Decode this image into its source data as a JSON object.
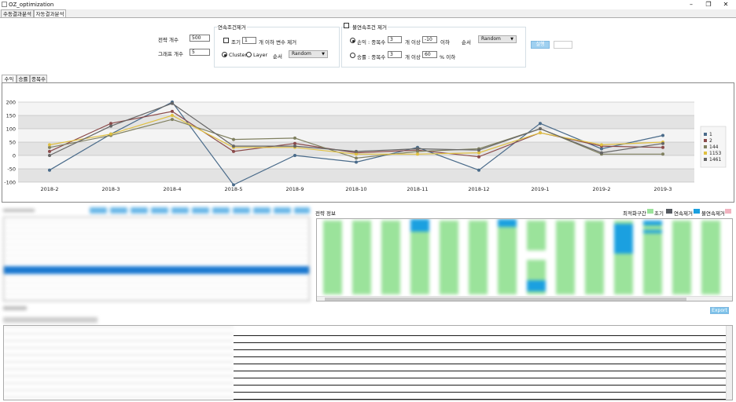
{
  "window": {
    "title": "OZ_optimization",
    "minimize": "–",
    "maximize": "❐",
    "close": "✕"
  },
  "main_tabs": [
    "수동결과분석",
    "자동결과분석"
  ],
  "params": {
    "strategy_count_label": "전략 개수",
    "strategy_count": "500",
    "graph_count_label": "그래프 개수",
    "graph_count": "5"
  },
  "cont_remove": {
    "title": "연속조건제거",
    "early_label": "조기",
    "early_value": "1",
    "early_suffix": "개 이하 변수 제거",
    "cluster_label": "Cluster",
    "layer_label": "Layer",
    "order_label": "순서",
    "order_value": "Random"
  },
  "noncont_remove": {
    "title": "불연속조건 제거",
    "loss_label": "손익 : 종목수",
    "loss_count": "3",
    "loss_mid": "개 이상",
    "loss_value": "-10",
    "loss_suffix": "이하",
    "order_label": "순서",
    "order_value": "Random",
    "win_label": "승률 : 종목수",
    "win_count": "3",
    "win_mid": "개 이상",
    "win_value": "60",
    "win_suffix": "% 이하"
  },
  "run_button": "실행",
  "chart_tabs": [
    "수익",
    "승률",
    "종목수"
  ],
  "strategy_info": {
    "title": "전략 정보",
    "legend_title": "최적화구간",
    "legend": [
      "초기",
      "연속제거",
      "불연속제거"
    ]
  },
  "export_button": "Export",
  "colors": {
    "early": "#9be39b",
    "cont": "#555a60",
    "noncont": "#1ba0e0",
    "dis": "#f2b3c0",
    "selection": "#1a78d0"
  },
  "chart_data": {
    "type": "line",
    "categories": [
      "2018-2",
      "2018-3",
      "2018-4",
      "2018-5",
      "2018-9",
      "2018-10",
      "2018-11",
      "2018-12",
      "2019-1",
      "2019-2",
      "2019-3"
    ],
    "ylim": [
      -100,
      200
    ],
    "yticks": [
      -100,
      -50,
      0,
      50,
      100,
      150,
      200
    ],
    "grid": true,
    "legend_position": "right",
    "series": [
      {
        "name": "1",
        "color": "#4a6b8a",
        "values": [
          -55,
          80,
          200,
          -110,
          0,
          -25,
          30,
          -55,
          120,
          25,
          75
        ]
      },
      {
        "name": "2",
        "color": "#8a4a4a",
        "values": [
          15,
          120,
          165,
          15,
          45,
          10,
          20,
          -5,
          85,
          35,
          30
        ]
      },
      {
        "name": "144",
        "color": "#808060",
        "values": [
          30,
          75,
          135,
          60,
          65,
          -10,
          15,
          25,
          100,
          5,
          5
        ]
      },
      {
        "name": "1153",
        "color": "#e0c040",
        "values": [
          40,
          80,
          150,
          30,
          30,
          5,
          5,
          10,
          85,
          40,
          50
        ]
      },
      {
        "name": "1461",
        "color": "#666666",
        "values": [
          0,
          110,
          195,
          35,
          35,
          15,
          25,
          20,
          100,
          10,
          45
        ]
      }
    ]
  }
}
